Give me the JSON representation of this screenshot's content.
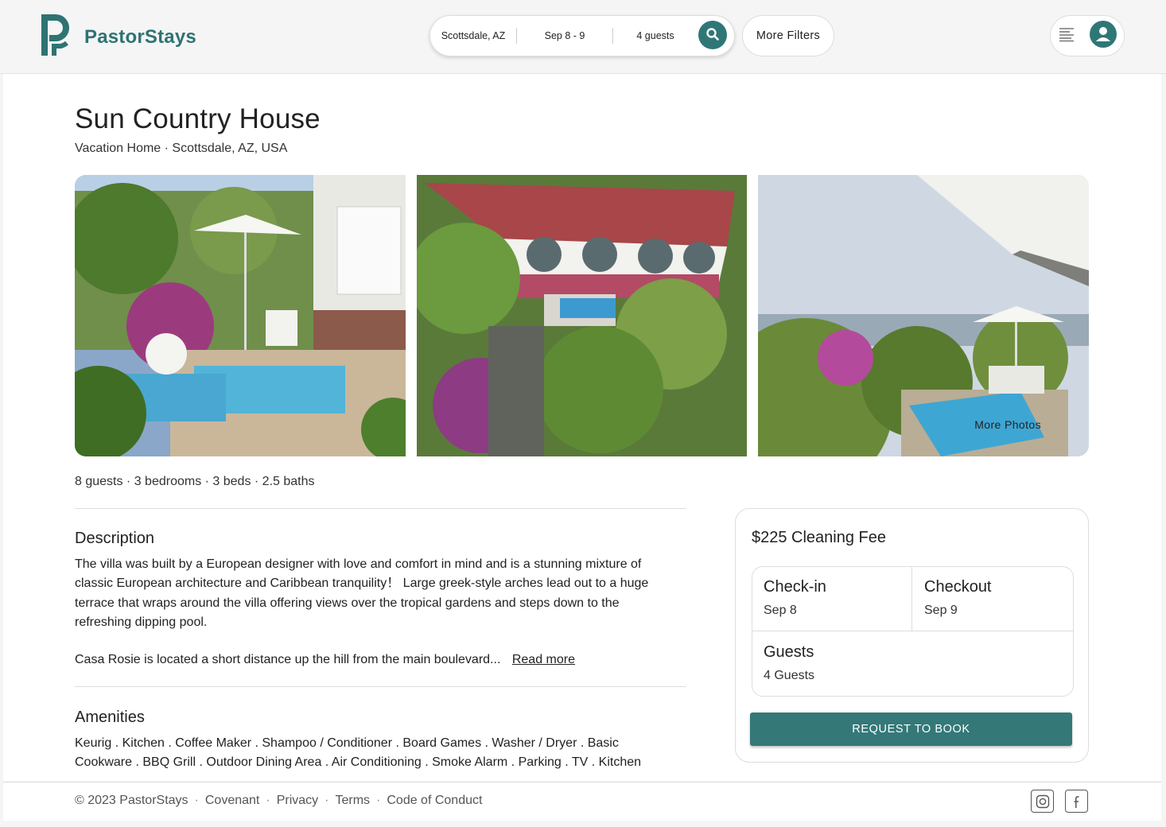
{
  "header": {
    "brand": "PastorStays",
    "search": {
      "location": "Scottsdale, AZ",
      "dates": "Sep 8 - 9",
      "guests": "4 guests"
    },
    "more_filters": "More Filters"
  },
  "listing": {
    "title": "Sun Country House",
    "subtitle": "Vacation Home · Scottsdale, AZ, USA",
    "more_photos": "More Photos",
    "specs": "8 guests · 3 bedrooms · 3 beds · 2.5 baths",
    "description_heading": "Description",
    "description": "The villa was built by a European designer with love and comfort in mind and is a stunning mixture of classic European architecture and Caribbean tranquility！ Large greek-style arches lead out to a huge terrace that wraps around the villa offering views over the tropical gardens and steps down to the refreshing dipping pool.",
    "description_more": "Casa Rosie is located a short distance up the hill from the main boulevard...",
    "read_more": "Read more",
    "amenities_heading": "Amenities",
    "amenities": "Keurig . Kitchen . Coffee Maker . Shampoo / Conditioner . Board Games . Washer / Dryer . Basic Cookware . BBQ Grill . Outdoor Dining Area . Air Conditioning . Smoke Alarm . Parking . TV . Kitchen"
  },
  "booking": {
    "fee": "$225 Cleaning Fee",
    "checkin_label": "Check-in",
    "checkin_value": "Sep 8",
    "checkout_label": "Checkout",
    "checkout_value": "Sep 9",
    "guests_label": "Guests",
    "guests_value": "4 Guests",
    "button": "REQUEST TO BOOK"
  },
  "footer": {
    "copyright": "© 2023 PastorStays",
    "links": [
      "Covenant",
      "Privacy",
      "Terms",
      "Code of Conduct"
    ],
    "separator": "·"
  },
  "colors": {
    "brand": "#2f7373",
    "button": "#347878"
  }
}
